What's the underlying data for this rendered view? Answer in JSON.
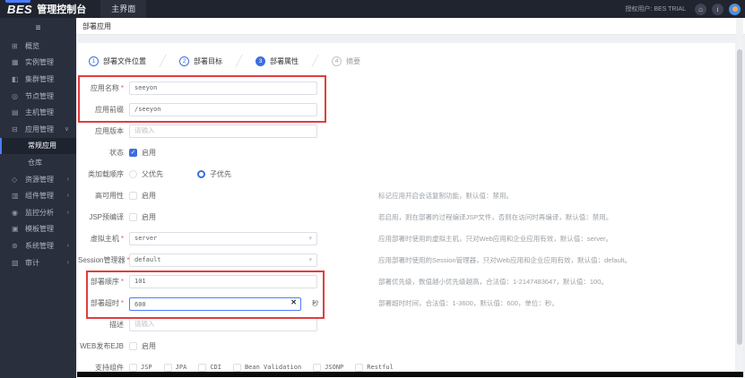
{
  "colors": {
    "accent_blue": "#3B6EE0",
    "annotation_red": "#E03E3E",
    "header_dark": "#20242E",
    "sidebar_dark": "#2A2F3D"
  },
  "header": {
    "logo": "BES",
    "product": "管理控制台",
    "tab_main": "主界面",
    "user_info": "授权用户: BES TRIAL"
  },
  "icons": {
    "collapse": "≡",
    "home": "⌂",
    "info": "i",
    "chevron_down": "∨",
    "chevron_right": "›",
    "dropdown_arrow": "▾",
    "clear": "✕",
    "check": "✓"
  },
  "breadcrumb": "部署应用",
  "steps": [
    {
      "num": "1",
      "label": "部署文件位置"
    },
    {
      "num": "2",
      "label": "部署目标"
    },
    {
      "num": "3",
      "label": "部署属性"
    },
    {
      "num": "4",
      "label": "摘要"
    }
  ],
  "sidebar": {
    "items": [
      {
        "label": "概览",
        "glyph": "⊞"
      },
      {
        "label": "实例管理",
        "glyph": "▦"
      },
      {
        "label": "集群管理",
        "glyph": "◧"
      },
      {
        "label": "节点管理",
        "glyph": "◎"
      },
      {
        "label": "主机管理",
        "glyph": "▤"
      },
      {
        "label": "应用管理",
        "glyph": "⊟",
        "arrow": "∨"
      },
      {
        "label": "常规应用"
      },
      {
        "label": "仓库"
      },
      {
        "label": "资源管理",
        "glyph": "◇",
        "arrow": "›"
      },
      {
        "label": "组件管理",
        "glyph": "▥",
        "arrow": "›"
      },
      {
        "label": "监控分析",
        "glyph": "◉",
        "arrow": "›"
      },
      {
        "label": "模板管理",
        "glyph": "▣"
      },
      {
        "label": "系统管理",
        "glyph": "⊛",
        "arrow": "›"
      },
      {
        "label": "审计",
        "glyph": "▧",
        "arrow": "›"
      }
    ]
  },
  "form": {
    "rows": {
      "app_name": {
        "label": "应用名称",
        "required": "*",
        "value": "seeyon"
      },
      "app_prefix": {
        "label": "应用前缀",
        "value": "/seeyon"
      },
      "app_version": {
        "label": "应用版本",
        "placeholder": "请输入"
      },
      "status": {
        "label": "状态",
        "checkbox": "启用"
      },
      "classload_order": {
        "label": "类加载顺序",
        "option1": "父优先",
        "option2": "子优先"
      },
      "high_availability": {
        "label": "高可用性",
        "checkbox": "启用",
        "hint": "标记应用开启会话复制功能，默认值：禁用。"
      },
      "jsp_precompile": {
        "label": "JSP预编译",
        "checkbox": "启用",
        "hint": "若启用，则在部署的过程编译JSP文件，否则在访问时再编译，默认值：禁用。"
      },
      "virtual_host": {
        "label": "虚拟主机",
        "required": "*",
        "value": "server",
        "hint": "应用部署时使用的虚拟主机，只对Web应用和企业应用有效，默认值：server。"
      },
      "session_manager": {
        "label": "Session管理器",
        "required": "*",
        "value": "default",
        "hint": "应用部署时使用的Session管理器，只对Web应用和企业应用有效，默认值：default。"
      },
      "deploy_order": {
        "label": "部署顺序",
        "required": "*",
        "value": "101",
        "hint": "部署优先级，数值越小优先级越高，合法值：1-2147483647，默认值：100。"
      },
      "deploy_timeout": {
        "label": "部署超时",
        "required": "*",
        "value": "600",
        "suffix": "秒",
        "hint": "部署超时时间，合法值：1-3600，默认值：600，单位：秒。"
      },
      "description": {
        "label": "描述",
        "placeholder": "请输入"
      },
      "web_publish_ejb": {
        "label": "WEB发布EJB",
        "checkbox": "启用"
      },
      "support_components": {
        "label": "支持组件",
        "options": [
          "JSP",
          "JPA",
          "CDI",
          "Bean Validation",
          "JSONP",
          "Restful"
        ]
      }
    }
  }
}
